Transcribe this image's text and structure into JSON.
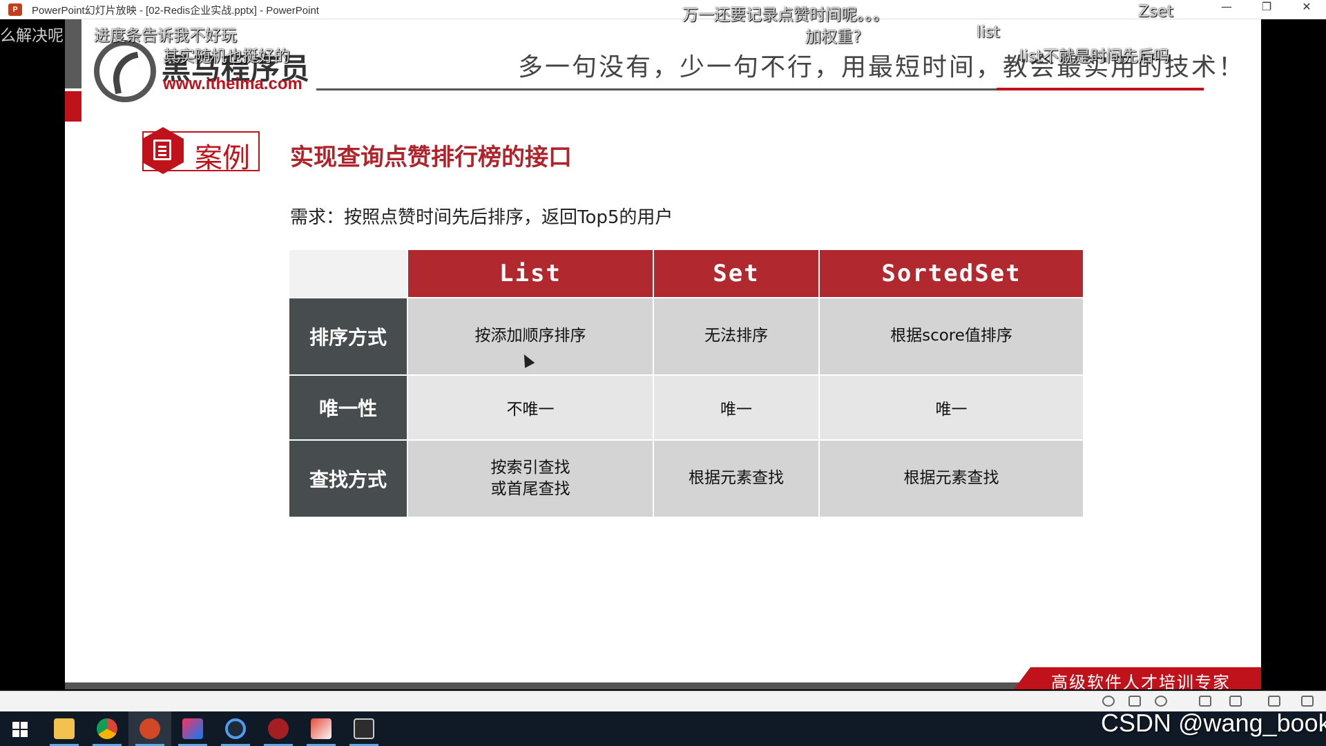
{
  "window": {
    "title": "PowerPoint幻灯片放映 - [02-Redis企业实战.pptx] - PowerPoint",
    "app_icon": "P",
    "controls": {
      "minimize": "—",
      "restore": "❐",
      "close": "✕"
    }
  },
  "slide": {
    "logo_cn": "黑马程序员",
    "logo_url": "www.itheima.com",
    "slogan": "多一句没有，少一句不行，用最短时间，教会最实用的技术！",
    "case_label": "案例",
    "case_title": "实现查询点赞排行榜的接口",
    "requirement": "需求：按照点赞时间先后排序，返回Top5的用户",
    "footer": "高级软件人才培训专家",
    "table": {
      "headers": [
        "List",
        "Set",
        "SortedSet"
      ],
      "rows": [
        {
          "label": "排序方式",
          "cells": [
            "按添加顺序排序",
            "无法排序",
            "根据score值排序"
          ]
        },
        {
          "label": "唯一性",
          "cells": [
            "不唯一",
            "唯一",
            "唯一"
          ]
        },
        {
          "label": "查找方式",
          "cells": [
            "按索引查找\n或首尾查找",
            "根据元素查找",
            "根据元素查找"
          ]
        }
      ]
    }
  },
  "danmaku": [
    "么解决呢",
    "进度条告诉我不好玩",
    "其实随机也挺好的",
    "万一还要记录点赞时间呢。。。",
    "加权重?",
    "list",
    "Zset",
    "list不就是时间先后吗"
  ],
  "watermark": "CSDN @wang_book",
  "taskbar": {
    "icons": [
      "windows-start",
      "file-explorer",
      "chrome",
      "powerpoint",
      "intellij",
      "browser",
      "redis-desktop",
      "app",
      "terminal"
    ]
  },
  "colors": {
    "accent_red": "#b1292f",
    "row_header": "#474d4f",
    "taskbar": "#101a26"
  }
}
